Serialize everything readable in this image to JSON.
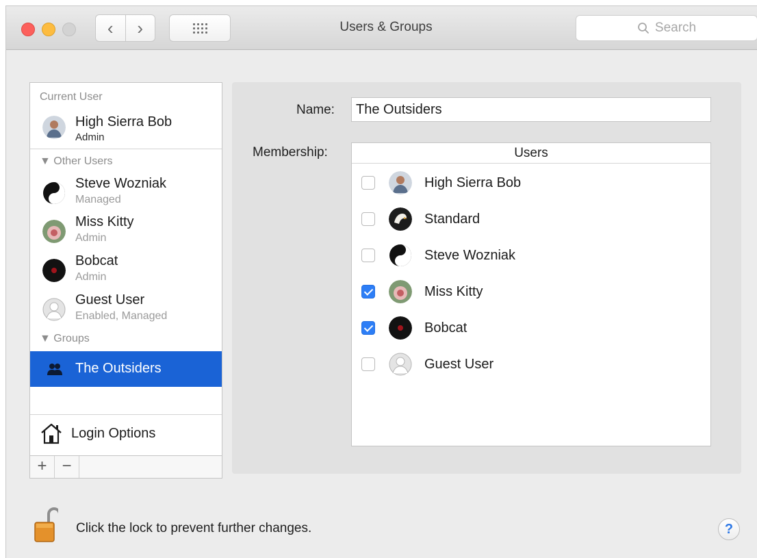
{
  "window": {
    "title": "Users & Groups",
    "search_placeholder": "Search",
    "back_glyph": "‹",
    "forward_glyph": "›"
  },
  "sidebar": {
    "current_user_heading": "Current User",
    "current_user": {
      "name": "High Sierra Bob",
      "role": "Admin",
      "icon": "user-avatar-bob"
    },
    "other_users_heading": "Other Users",
    "other_users": [
      {
        "name": "Steve Wozniak",
        "role": "Managed",
        "icon": "yin-yang-avatar"
      },
      {
        "name": "Miss Kitty",
        "role": "Admin",
        "icon": "flower-avatar"
      },
      {
        "name": "Bobcat",
        "role": "Admin",
        "icon": "dark-avatar"
      },
      {
        "name": "Guest User",
        "role": "Enabled, Managed",
        "icon": "guest-avatar"
      }
    ],
    "groups_heading": "Groups",
    "groups": [
      {
        "name": "The Outsiders",
        "selected": true,
        "icon": "group-icon"
      }
    ],
    "login_options_label": "Login Options",
    "add_label": "+",
    "remove_label": "−"
  },
  "detail": {
    "name_label": "Name:",
    "name_value": "The Outsiders",
    "membership_label": "Membership:",
    "table_header": "Users",
    "members": [
      {
        "name": "High Sierra Bob",
        "checked": false,
        "icon": "user-avatar-bob"
      },
      {
        "name": "Standard",
        "checked": false,
        "icon": "eagle-avatar"
      },
      {
        "name": "Steve Wozniak",
        "checked": false,
        "icon": "yin-yang-avatar"
      },
      {
        "name": "Miss Kitty",
        "checked": true,
        "icon": "flower-avatar"
      },
      {
        "name": "Bobcat",
        "checked": true,
        "icon": "dark-avatar"
      },
      {
        "name": "Guest User",
        "checked": false,
        "icon": "guest-avatar"
      }
    ]
  },
  "footer": {
    "lock_text": "Click the lock to prevent further changes.",
    "help_label": "?"
  },
  "colors": {
    "selection": "#1a63d6",
    "checkbox_on": "#2d7ef6",
    "close": "#fc605c",
    "minimize": "#fdbc40"
  }
}
